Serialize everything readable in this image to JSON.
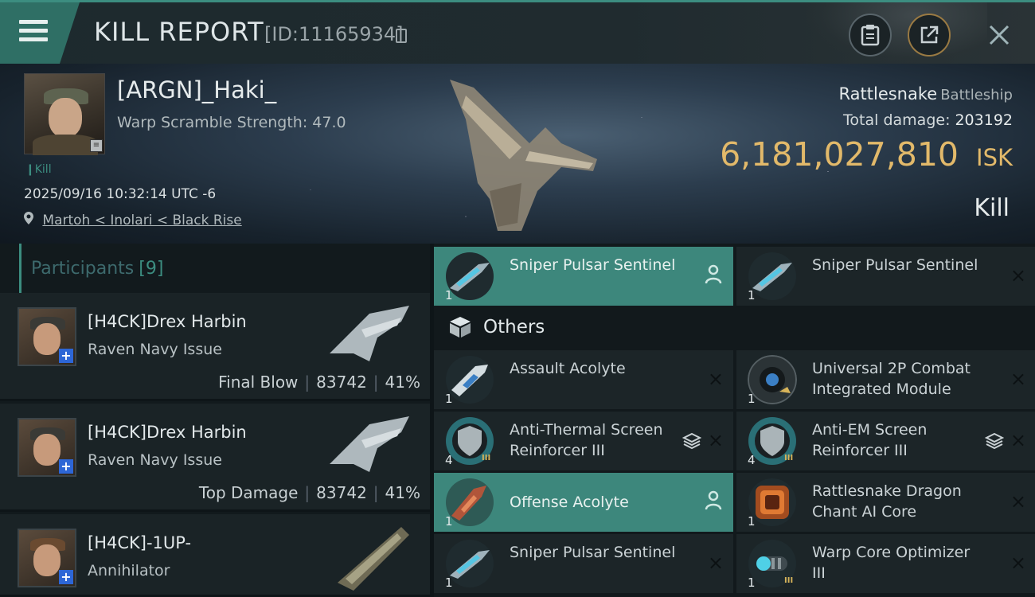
{
  "header": {
    "title": "KILL REPORT",
    "report_id": "[ID:11165934]",
    "icons": [
      "menu-icon",
      "copy-icon",
      "clipboard-icon",
      "share-icon",
      "close-icon"
    ]
  },
  "victim": {
    "name": "[ARGN]_Haki_",
    "warp_scramble": "Warp Scramble Strength: 47.0",
    "kill_tag": "Kill",
    "datetime": "2025/09/16 10:32:14 UTC -6",
    "location": "Martoh < Inolari < Black Rise",
    "ship_name": "Rattlesnake",
    "ship_class": "Battleship",
    "total_damage_label": "Total damage:",
    "total_damage": "203192",
    "isk_value": "6,181,027,810",
    "isk_unit": "ISK",
    "result": "Kill"
  },
  "participants": {
    "label": "Participants",
    "count": "[9]",
    "rows": [
      {
        "name": "[H4CK]Drex Harbin",
        "ship": "Raven Navy Issue",
        "role": "Final Blow",
        "damage": "83742",
        "percent": "41%"
      },
      {
        "name": "[H4CK]Drex Harbin",
        "ship": "Raven Navy Issue",
        "role": "Top Damage",
        "damage": "83742",
        "percent": "41%"
      },
      {
        "name": "[H4CK]-1UP-",
        "ship": "Annihilator",
        "role": "",
        "damage": "",
        "percent": ""
      }
    ]
  },
  "items": {
    "top": [
      {
        "name": "Sniper Pulsar Sentinel",
        "qty": "1"
      },
      {
        "name": "Sniper Pulsar Sentinel",
        "qty": "1"
      }
    ],
    "others_label": "Others",
    "others": [
      {
        "name": "Assault Acolyte",
        "qty": "1"
      },
      {
        "name": "Universal 2P Combat Integrated Module",
        "qty": "1"
      },
      {
        "name": "Anti-Thermal Screen Reinforcer III",
        "qty": "4"
      },
      {
        "name": "Anti-EM Screen Reinforcer III",
        "qty": "4"
      },
      {
        "name": "Offense  Acolyte",
        "qty": "1"
      },
      {
        "name": "Rattlesnake Dragon Chant AI Core",
        "qty": "1"
      },
      {
        "name": "Sniper Pulsar Sentinel",
        "qty": "1"
      },
      {
        "name": "Warp Core Optimizer III",
        "qty": "1"
      }
    ],
    "tier_label": "III",
    "close_glyph": "×"
  },
  "colors": {
    "accent": "#3c8d80",
    "isk_gold": "#e2b96a",
    "background": "#0e1518"
  }
}
